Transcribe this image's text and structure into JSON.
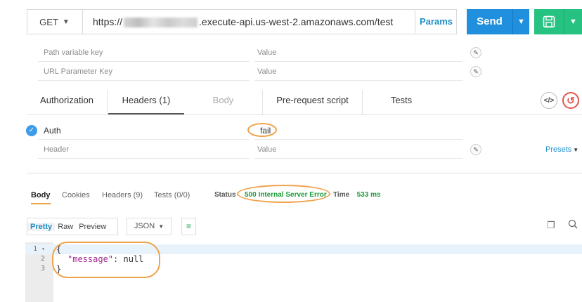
{
  "request": {
    "method": "GET",
    "url_prefix": "https://",
    "url_suffix": ".execute-api.us-west-2.amazonaws.com/test",
    "params_label": "Params",
    "send_label": "Send"
  },
  "path_rows": [
    {
      "key_placeholder": "Path variable key",
      "value_placeholder": "Value"
    },
    {
      "key_placeholder": "URL Parameter Key",
      "value_placeholder": "Value"
    }
  ],
  "request_tabs": [
    "Authorization",
    "Headers (1)",
    "Body",
    "Pre-request script",
    "Tests"
  ],
  "headers": {
    "rows": [
      {
        "key": "Auth",
        "value": "fail",
        "enabled": true
      }
    ],
    "new_key_placeholder": "Header",
    "new_value_placeholder": "Value",
    "presets_label": "Presets"
  },
  "response": {
    "tabs": [
      "Body",
      "Cookies",
      "Headers (9)",
      "Tests (0/0)"
    ],
    "status_label": "Status",
    "status_value": "500 Internal Server Error",
    "time_label": "Time",
    "time_value": "533 ms",
    "modes": [
      "Pretty",
      "Raw",
      "Preview"
    ],
    "format": "JSON",
    "line_numbers": [
      "1",
      "2",
      "3"
    ],
    "code_open": "{",
    "code_key": "\"message\"",
    "code_sep": ": ",
    "code_value": "null",
    "code_close": "}"
  },
  "colors": {
    "send": "#1f8fde",
    "save": "#26c281",
    "status_ok_text": "#1e9c3a",
    "highlight_oval": "#f0a24a",
    "link": "#1d8ec9"
  }
}
